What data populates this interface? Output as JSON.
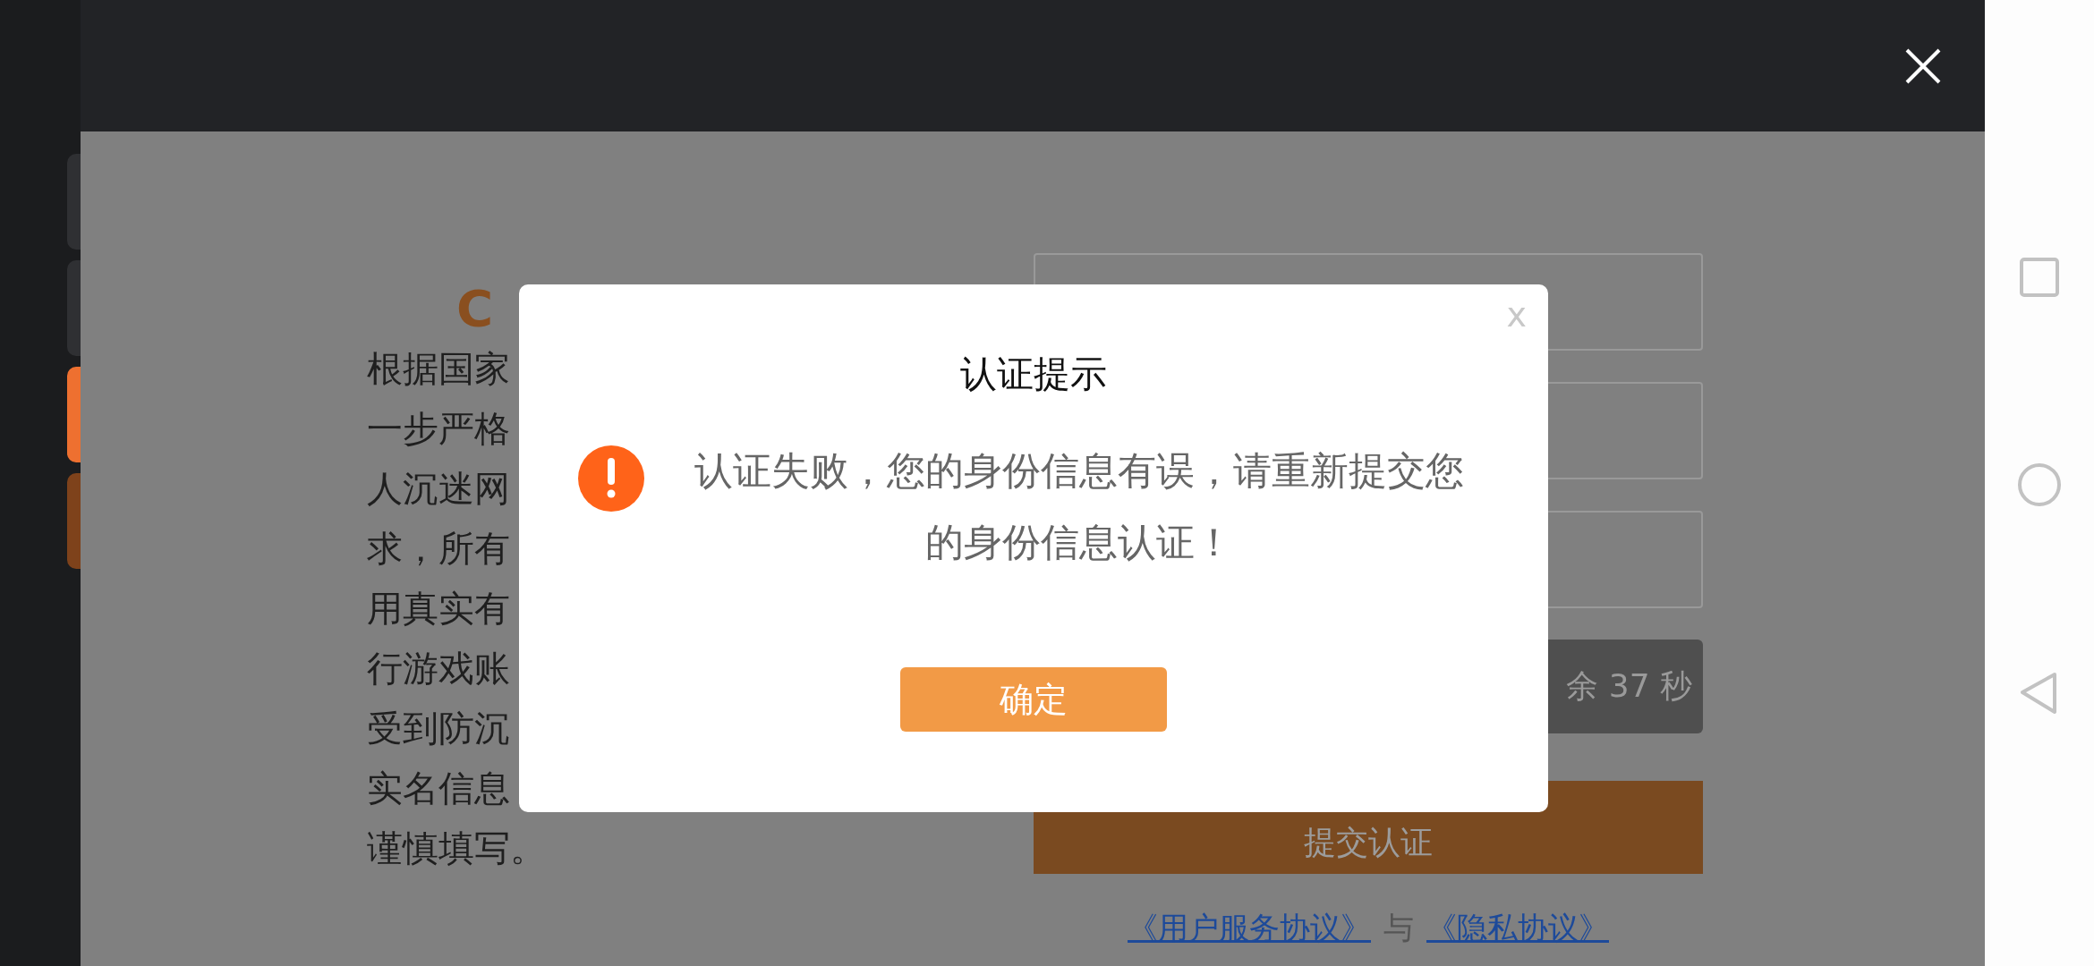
{
  "page": {
    "logo": "C",
    "notice_lines": [
      "根据国家",
      "一步严格",
      "人沉迷网",
      "求，所有",
      "用真实有",
      "行游戏账",
      "受到防沉",
      "实名信息",
      "谨慎填写。"
    ],
    "countdown_button": {
      "label": "余 37 秒",
      "disabled": true
    },
    "submit_button": {
      "label": "提交认证"
    },
    "agreement": {
      "links": [
        "《用户服务协议》",
        "《隐私协议》"
      ],
      "separator": "与"
    }
  },
  "dialog": {
    "title": "认证提示",
    "close": "x",
    "message": "认证失败，您的身份信息有误，请重新提交您的身份信息认证！",
    "confirm": "确定"
  }
}
